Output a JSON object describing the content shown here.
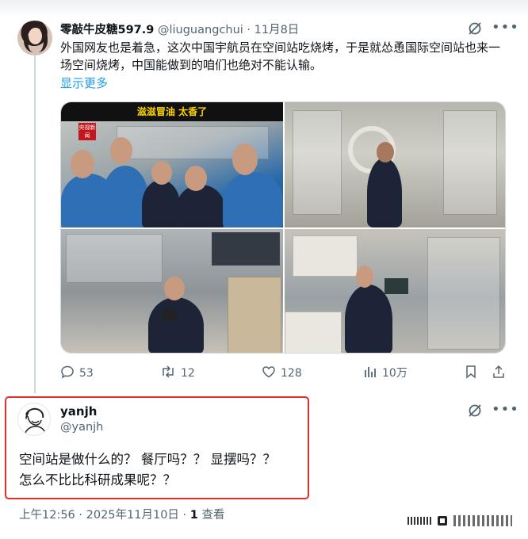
{
  "tweet": {
    "display_name": "零敲牛皮糖597.9",
    "handle": "@liuguangchui",
    "separator": "·",
    "date": "11月8日",
    "text": "外国网友也是着急，这次中国宇航员在空间站吃烧烤，于是就怂恿国际空间站也来一场空间烧烤，中国能做到的咱们也绝对不能认输。",
    "show_more": "显示更多",
    "media": {
      "caption": "滋滋冒油 太香了",
      "channel_logo": "央视新闻"
    },
    "actions": {
      "replies": "53",
      "retweets": "12",
      "likes": "128",
      "views": "10万"
    }
  },
  "reply": {
    "display_name": "yanjh",
    "handle": "@yanjh",
    "text_line1": "空间站是做什么的？ 餐厅吗？？ 显摆吗？？",
    "text_line2": "怎么不比比科研成果呢？？",
    "timestamp": "上午12:56 · 2025年11月10日 ·",
    "view_count": "1",
    "view_label": "查看"
  },
  "icons": [
    "reply-icon",
    "retweet-icon",
    "like-icon",
    "views-icon",
    "bookmark-icon",
    "share-icon",
    "grok-icon",
    "more-icon"
  ],
  "colors": {
    "link": "#1d9bf0",
    "muted": "#536471",
    "highlight_box": "#e0302a"
  }
}
